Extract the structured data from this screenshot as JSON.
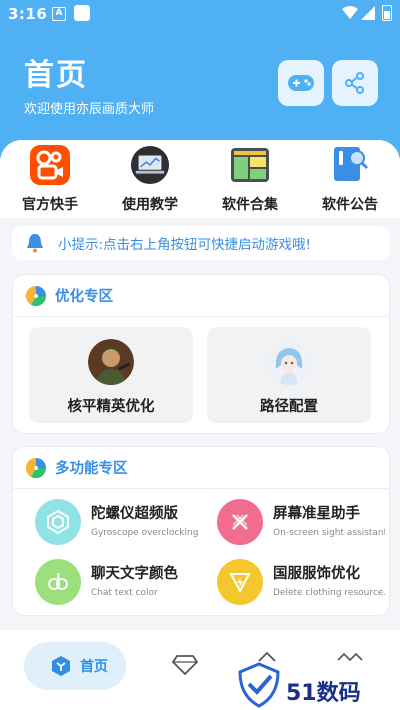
{
  "status": {
    "time": "3:16",
    "notif_a": "A"
  },
  "header": {
    "title": "首页",
    "subtitle": "欢迎使用亦辰画质大师"
  },
  "tiles": [
    {
      "label": "官方快手"
    },
    {
      "label": "使用教学"
    },
    {
      "label": "软件合集"
    },
    {
      "label": "软件公告"
    }
  ],
  "notice": {
    "text": "小提示:点击右上角按钮可快捷启动游戏哦!"
  },
  "optimize": {
    "title": "优化专区",
    "cards": [
      {
        "label": "核平精英优化"
      },
      {
        "label": "路径配置"
      }
    ]
  },
  "multi": {
    "title": "多功能专区",
    "features": [
      {
        "name": "陀螺仪超频版",
        "desc": "Gyroscope overclocking",
        "color": "#8fe3e6"
      },
      {
        "name": "屏幕准星助手",
        "desc": "On-screen sight assistant",
        "color": "#f06d8f"
      },
      {
        "name": "聊天文字颜色",
        "desc": "Chat text color",
        "color": "#9be07a"
      },
      {
        "name": "国服服饰优化",
        "desc": "Delete clothing resource...",
        "color": "#f5c72e"
      }
    ]
  },
  "nav": {
    "home_label": "首页"
  },
  "watermark": {
    "text": "51数码"
  },
  "colors": {
    "primary": "#4fb0f3",
    "accent_text": "#3a8ee6"
  }
}
